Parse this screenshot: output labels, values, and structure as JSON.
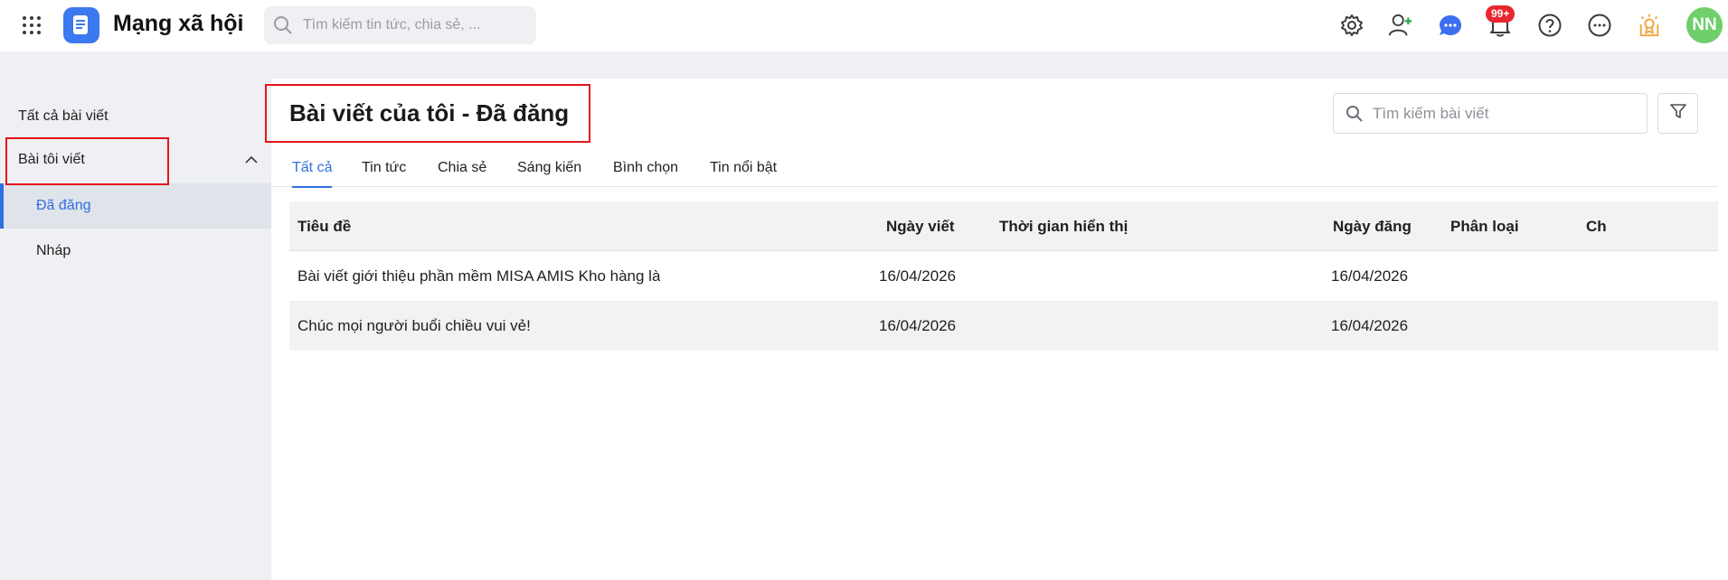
{
  "header": {
    "app_title": "Mạng xã hội",
    "search_placeholder": "Tìm kiếm tin tức, chia sẻ, ...",
    "notification_badge": "99+",
    "avatar_initials": "NN",
    "accent_color": "#3c78f0",
    "icons": [
      "apps-grid-icon",
      "app-logo-icon",
      "settings-icon",
      "add-user-icon",
      "chat-icon",
      "bell-icon",
      "help-icon",
      "more-icon",
      "award-icon"
    ]
  },
  "sidebar": {
    "items": [
      {
        "label": "Tất cả bài viết"
      },
      {
        "label": "Bài tôi viết",
        "expanded": true
      },
      {
        "label": "Đã đăng",
        "active": true
      },
      {
        "label": "Nháp"
      }
    ]
  },
  "main": {
    "title": "Bài viết của tôi - Đã đăng",
    "search_placeholder": "Tìm kiếm bài viết",
    "tabs": [
      {
        "label": "Tất cả",
        "active": true
      },
      {
        "label": "Tin tức"
      },
      {
        "label": "Chia sẻ"
      },
      {
        "label": "Sáng kiến"
      },
      {
        "label": "Bình chọn"
      },
      {
        "label": "Tin nổi bật"
      }
    ],
    "table": {
      "columns": [
        "Tiêu đề",
        "Ngày viết",
        "Thời gian hiển thị",
        "Ngày đăng",
        "Phân loại",
        "Ch"
      ],
      "rows": [
        {
          "title": "Bài viết giới thiệu phần mềm MISA AMIS Kho hàng là",
          "written": "16/04/2026",
          "display_time": "",
          "published": "16/04/2026",
          "category": ""
        },
        {
          "title": "Chúc mọi người buổi chiều vui vẻ!",
          "written": "16/04/2026",
          "display_time": "",
          "published": "16/04/2026",
          "category": ""
        }
      ]
    }
  }
}
